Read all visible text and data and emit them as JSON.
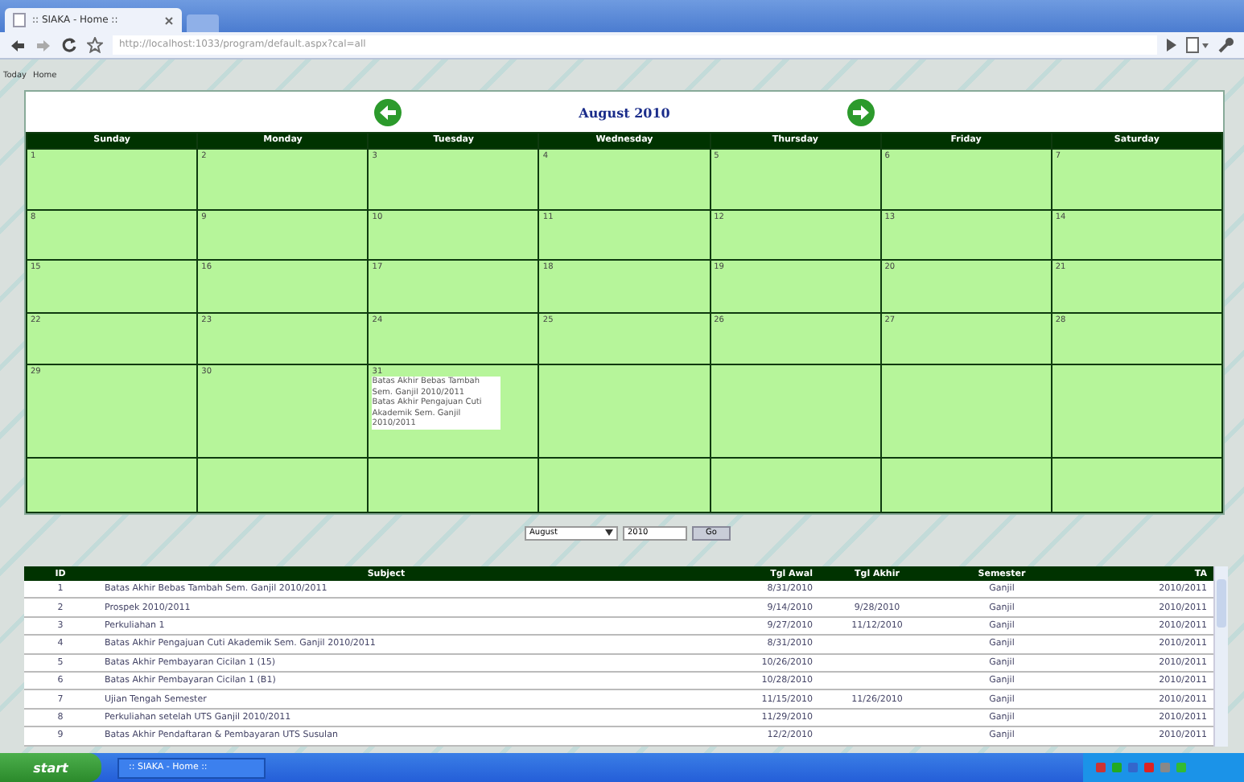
{
  "browser": {
    "tab_title": ":: SIAKA - Home ::",
    "url": "http://localhost:1033/program/default.aspx?cal=all"
  },
  "breadcrumb": [
    "Today",
    "Home"
  ],
  "calendar": {
    "title": "August 2010",
    "weekdays": [
      "Sunday",
      "Monday",
      "Tuesday",
      "Wednesday",
      "Thursday",
      "Friday",
      "Saturday"
    ],
    "weeks": [
      [
        {
          "day": "1"
        },
        {
          "day": "2"
        },
        {
          "day": "3"
        },
        {
          "day": "4"
        },
        {
          "day": "5"
        },
        {
          "day": "6"
        },
        {
          "day": "7"
        }
      ],
      [
        {
          "day": "8"
        },
        {
          "day": "9"
        },
        {
          "day": "10"
        },
        {
          "day": "11"
        },
        {
          "day": "12"
        },
        {
          "day": "13"
        },
        {
          "day": "14"
        }
      ],
      [
        {
          "day": "15"
        },
        {
          "day": "16"
        },
        {
          "day": "17"
        },
        {
          "day": "18"
        },
        {
          "day": "19"
        },
        {
          "day": "20"
        },
        {
          "day": "21"
        }
      ],
      [
        {
          "day": "22"
        },
        {
          "day": "23"
        },
        {
          "day": "24"
        },
        {
          "day": "25"
        },
        {
          "day": "26"
        },
        {
          "day": "27"
        },
        {
          "day": "28"
        }
      ],
      [
        {
          "day": "29"
        },
        {
          "day": "30"
        },
        {
          "day": "31",
          "events": [
            "Batas Akhir Bebas Tambah Sem. Ganjil 2010/2011",
            "Batas Akhir Pengajuan Cuti Akademik Sem. Ganjil 2010/2011"
          ]
        }
      ]
    ]
  },
  "month_select": {
    "value": "August"
  },
  "year_field": {
    "value": "2010"
  },
  "go_button": "Go",
  "table": {
    "columns": [
      "ID",
      "Subject",
      "Tgl Awal",
      "Tgl Akhir",
      "Semester",
      "TA"
    ],
    "rows": [
      [
        "1",
        "Batas Akhir Bebas Tambah Sem. Ganjil 2010/2011",
        "8/31/2010",
        "",
        "Ganjil",
        "2010/2011"
      ],
      [
        "2",
        "Prospek 2010/2011",
        "9/14/2010",
        "9/28/2010",
        "Ganjil",
        "2010/2011"
      ],
      [
        "3",
        "Perkuliahan 1",
        "9/27/2010",
        "11/12/2010",
        "Ganjil",
        "2010/2011"
      ],
      [
        "4",
        "Batas Akhir Pengajuan Cuti Akademik Sem. Ganjil 2010/2011",
        "8/31/2010",
        "",
        "Ganjil",
        "2010/2011"
      ],
      [
        "5",
        "Batas Akhir Pembayaran Cicilan 1 (15)",
        "10/26/2010",
        "",
        "Ganjil",
        "2010/2011"
      ],
      [
        "6",
        "Batas Akhir Pembayaran Cicilan 1 (B1)",
        "10/28/2010",
        "",
        "Ganjil",
        "2010/2011"
      ],
      [
        "7",
        "Ujian Tengah Semester",
        "11/15/2010",
        "11/26/2010",
        "Ganjil",
        "2010/2011"
      ],
      [
        "8",
        "Perkuliahan setelah UTS Ganjil 2010/2011",
        "11/29/2010",
        "",
        "Ganjil",
        "2010/2011"
      ],
      [
        "9",
        "Batas Akhir Pendaftaran & Pembayaran UTS Susulan",
        "12/2/2010",
        "",
        "Ganjil",
        "2010/2011"
      ]
    ]
  },
  "taskbar": {
    "start": "start",
    "task": ":: SIAKA - Home ::"
  }
}
